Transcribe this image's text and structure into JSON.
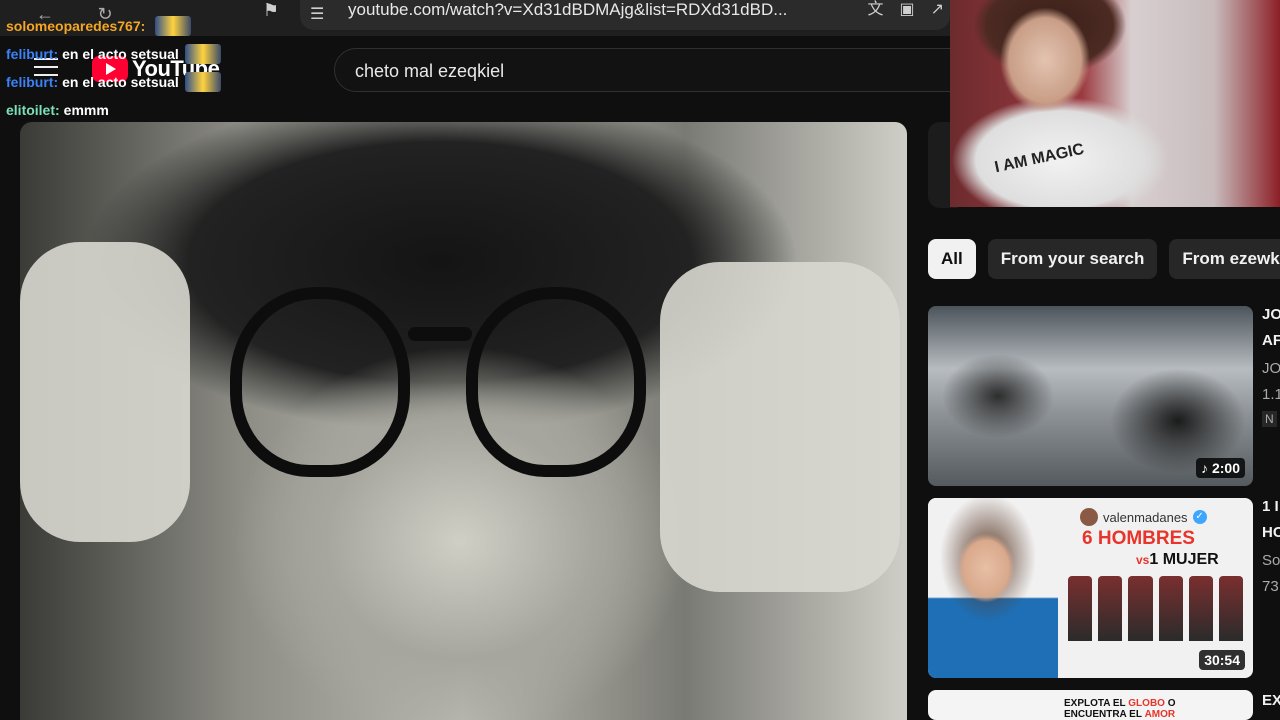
{
  "browser": {
    "url": "youtube.com/watch?v=Xd31dBDMAjg&list=RDXd31dBD...",
    "icons": [
      "back-icon",
      "reload-icon",
      "bookmark-icon",
      "tune-icon",
      "translate-icon",
      "cast-icon",
      "share-icon"
    ]
  },
  "youtube": {
    "logo_text": "YouTube",
    "search_value": "cheto mal ezeqkiel"
  },
  "chat": [
    {
      "user": "solomeoparedes767:",
      "message": "",
      "color": "#f5a623"
    },
    {
      "user": "feliburt:",
      "message": "en el acto setsual",
      "color": "#3b82f6"
    },
    {
      "user": "feliburt:",
      "message": "en el acto setsual",
      "color": "#3b82f6"
    },
    {
      "user": "elitoilet:",
      "message": "emmm",
      "color": "#7be0b6"
    }
  ],
  "webcam": {
    "shirt_text": "I AM MAGIC"
  },
  "chips": [
    {
      "label": "All",
      "active": true
    },
    {
      "label": "From your search",
      "active": false
    },
    {
      "label": "From ezewk",
      "active": false
    }
  ],
  "recommendations": [
    {
      "duration": "2:00",
      "music": true,
      "meta": [
        "JO",
        "AF",
        "JO",
        "1.1",
        "N"
      ]
    },
    {
      "duration": "30:54",
      "channel_handle": "valenmadanes",
      "title_line1": "6 HOMBRES",
      "title_vs": "vs",
      "title_line2": "1 MUJER",
      "meta": [
        "1 I",
        "HC",
        "So",
        "73"
      ]
    },
    {
      "thumb_line1a": "EXPLOTA EL ",
      "thumb_line1b": "GLOBO",
      "thumb_line1c": " O",
      "thumb_line2a": "ENCUENTRA EL ",
      "thumb_line2b": "AMOR",
      "meta": [
        "EX"
      ]
    }
  ]
}
